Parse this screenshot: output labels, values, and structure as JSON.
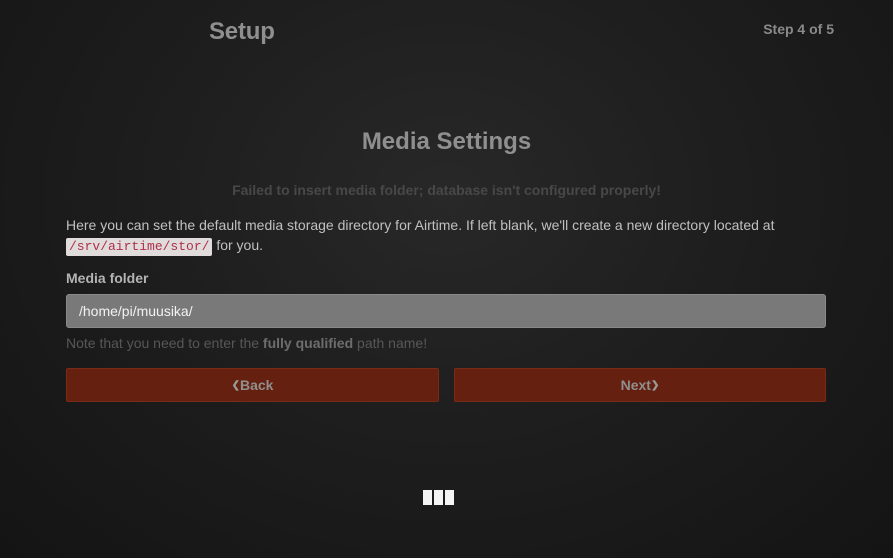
{
  "header": {
    "title": "Setup",
    "step": "Step 4 of 5"
  },
  "section": {
    "title": "Media Settings",
    "error": "Failed to insert media folder; database isn't configured properly!"
  },
  "description": {
    "before": "Here you can set the default media storage directory for Airtime. If left blank, we'll create a new directory located at",
    "code_path": "/srv/airtime/stor/",
    "after": "for you."
  },
  "media_folder": {
    "label": "Media folder",
    "value": "/home/pi/muusika/"
  },
  "help": {
    "before": "Note that you need to enter the",
    "emphasis": "fully qualified",
    "after": "path name!"
  },
  "buttons": {
    "back_label": "Back",
    "next_label": "Next"
  },
  "icons": {
    "back": "chevron-left-icon",
    "next": "chevron-right-icon",
    "loader": "loading-bars-icon"
  },
  "colors": {
    "button_bg": "#66200f",
    "input_bg": "#797979",
    "code_text": "#b0304a"
  }
}
